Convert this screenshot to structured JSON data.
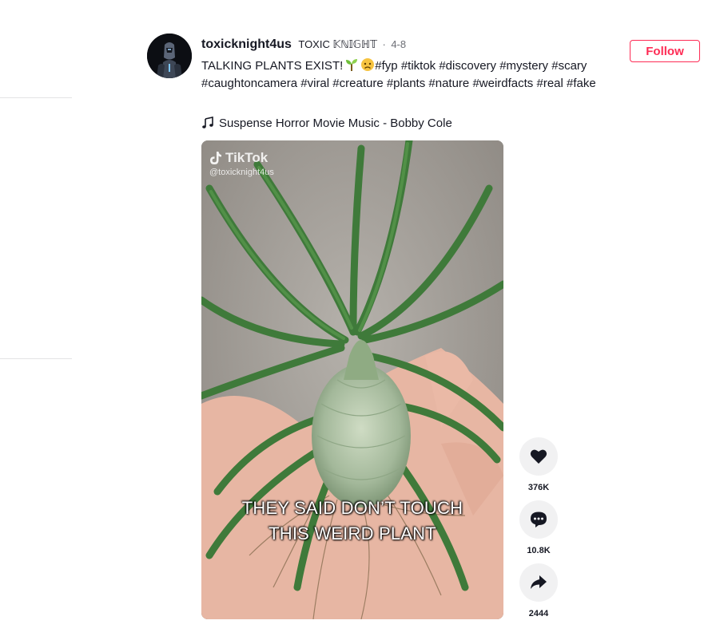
{
  "author": {
    "username": "toxicknight4us",
    "nickname": "TOXIC 𝕂ℕ𝕀𝔾ℍ𝕋",
    "separator": "·",
    "date": "4-8",
    "avatar_icon": "knight-avatar"
  },
  "follow_button": {
    "label": "Follow",
    "color": "#fe2c55"
  },
  "caption": {
    "text": "TALKING PLANTS EXIST!",
    "emojis": [
      "seedling-emoji",
      "worried-face-emoji"
    ],
    "hashtags": [
      "#fyp",
      "#tiktok",
      "#discovery",
      "#mystery",
      "#scary",
      "#caughtoncamera",
      "#viral",
      "#creature",
      "#plants",
      "#nature",
      "#weirdfacts",
      "#real",
      "#fake"
    ]
  },
  "music": {
    "icon": "music-note-icon",
    "title": "Suspense Horror Movie Music - Bobby Cole"
  },
  "video": {
    "watermark_brand": "TikTok",
    "watermark_handle": "@toxicknight4us",
    "subtitle_line1": "THEY SAID DON’T TOUCH",
    "subtitle_line2": "THIS WEIRD PLANT"
  },
  "actions": {
    "like": {
      "icon": "heart-icon",
      "count": "376K"
    },
    "comment": {
      "icon": "comment-icon",
      "count": "10.8K"
    },
    "share": {
      "icon": "share-icon",
      "count": "2444"
    }
  }
}
